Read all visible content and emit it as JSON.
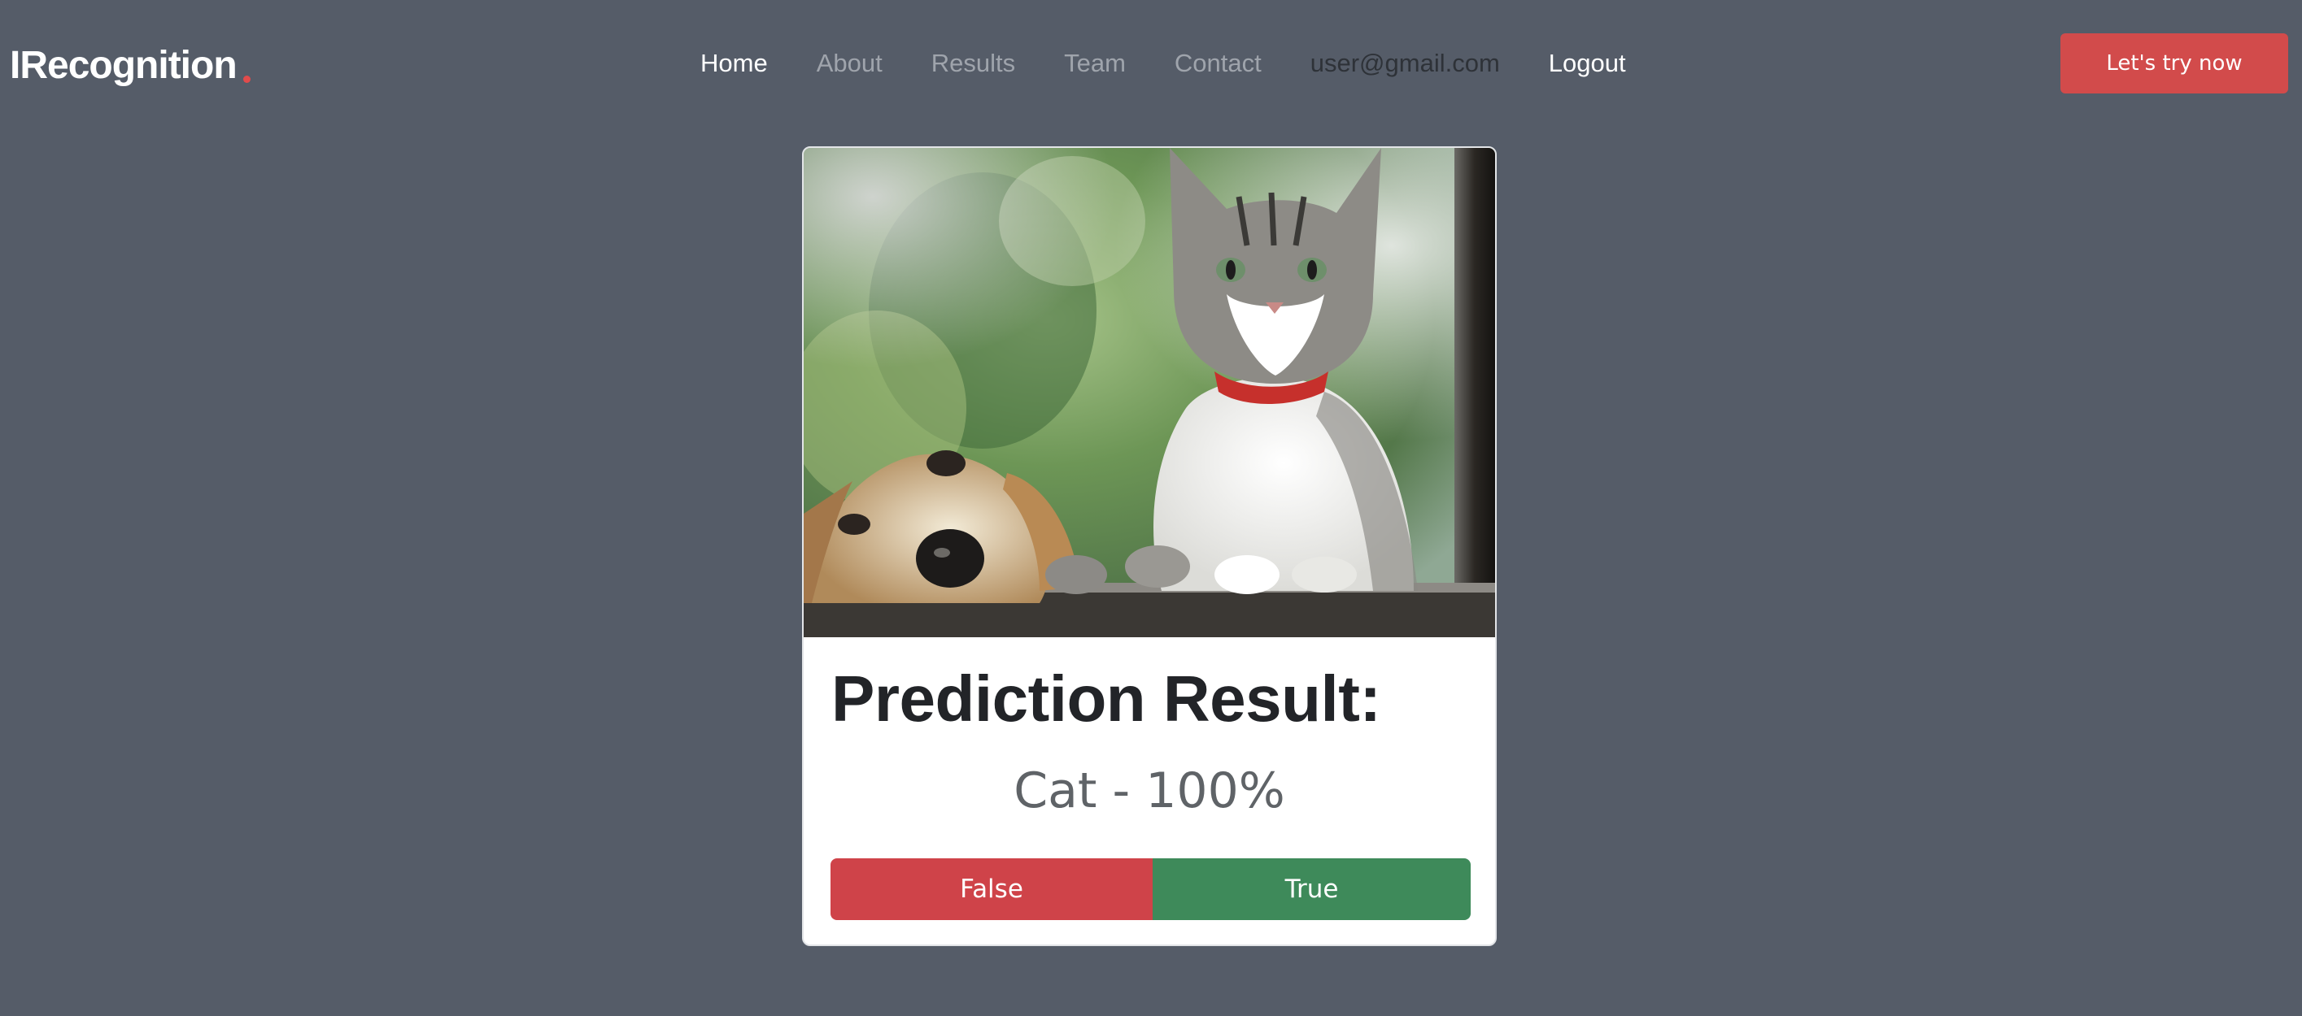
{
  "header": {
    "logo_text": "IRecognition",
    "logo_dot_color": "#e24b4b",
    "nav": [
      {
        "label": "Home",
        "state": "active"
      },
      {
        "label": "About",
        "state": "muted"
      },
      {
        "label": "Results",
        "state": "muted"
      },
      {
        "label": "Team",
        "state": "muted"
      },
      {
        "label": "Contact",
        "state": "muted"
      },
      {
        "label": "user@gmail.com",
        "state": "user"
      },
      {
        "label": "Logout",
        "state": "bright"
      }
    ],
    "cta_label": "Let's try now"
  },
  "card": {
    "image_subject": "cat and dog looking through a window",
    "title": "Prediction Result:",
    "prediction": "Cat - 100%",
    "false_label": "False",
    "true_label": "True"
  },
  "colors": {
    "background": "#555c68",
    "accent": "#d24b4b",
    "false": "#cf4349",
    "true": "#3e8a5a"
  }
}
